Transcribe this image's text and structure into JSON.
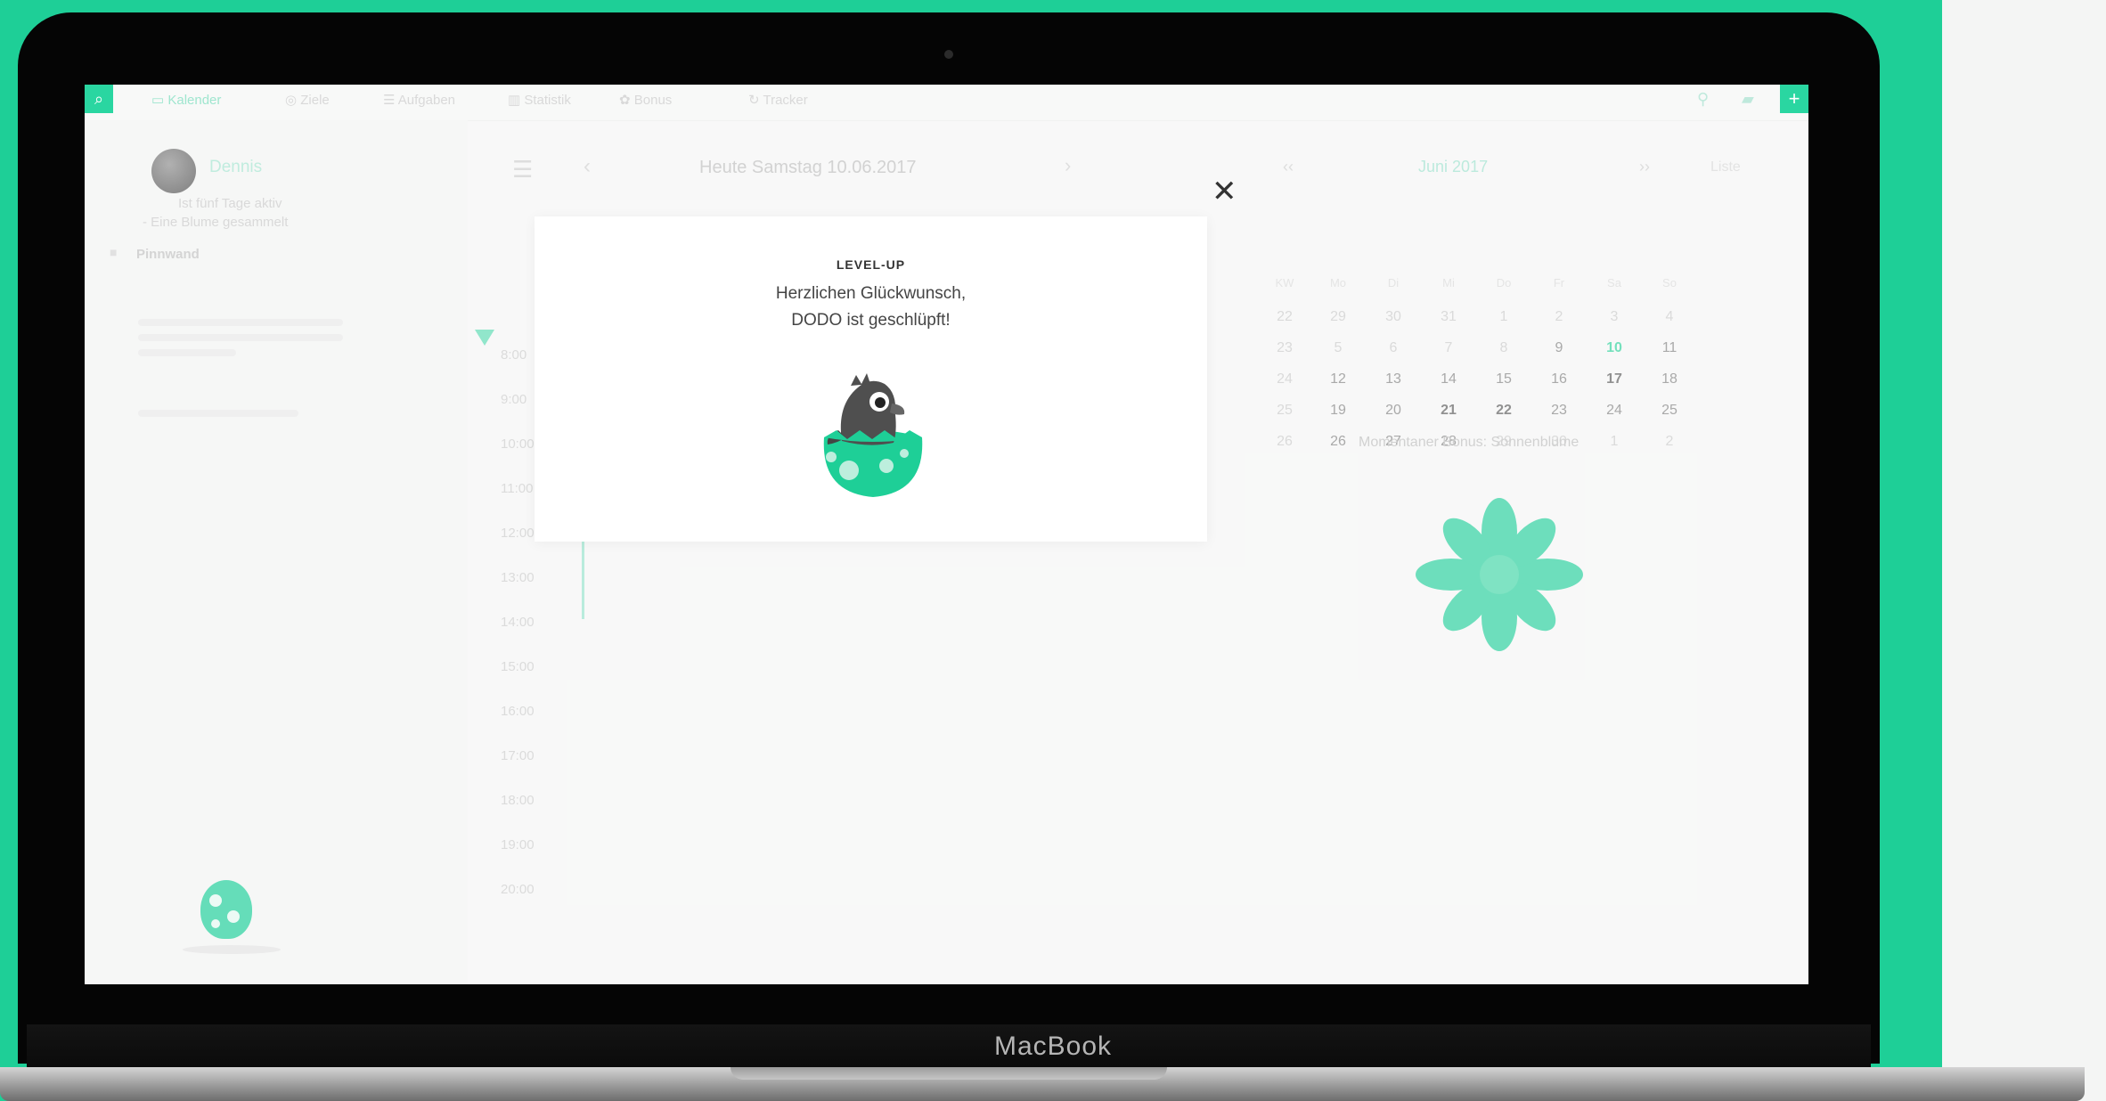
{
  "device": {
    "brand": "MacBook"
  },
  "app": {
    "nav_tabs": [
      {
        "label": "Kalender",
        "active": true
      },
      {
        "label": "Ziele",
        "active": false
      },
      {
        "label": "Aufgaben",
        "active": false
      },
      {
        "label": "Statistik",
        "active": false
      },
      {
        "label": "Bonus",
        "active": false
      },
      {
        "label": "Tracker",
        "active": false
      }
    ]
  },
  "sidebar": {
    "username": "Dennis",
    "status_line1": "Ist fünf Tage aktiv",
    "status_line2": "- Eine Blume gesammelt",
    "section_label": "Pinnwand"
  },
  "day_header": {
    "today_label": "Heute Samstag 10.06.2017"
  },
  "timeline": {
    "times": [
      "8:00",
      "9:00",
      "10:00",
      "11:00",
      "12:00",
      "13:00",
      "14:00",
      "15:00",
      "16:00",
      "17:00",
      "18:00",
      "19:00",
      "20:00"
    ]
  },
  "calendar": {
    "month": "Juni",
    "year": "2017",
    "option_label": "Liste",
    "weekday_headers": [
      "KW",
      "Mo",
      "Di",
      "Mi",
      "Do",
      "Fr",
      "Sa",
      "So"
    ],
    "rows": [
      [
        "22",
        "29",
        "30",
        "31",
        "1",
        "2",
        "3",
        "4"
      ],
      [
        "23",
        "5",
        "6",
        "7",
        "8",
        "9",
        "10",
        "11"
      ],
      [
        "24",
        "12",
        "13",
        "14",
        "15",
        "16",
        "17",
        "18"
      ],
      [
        "25",
        "19",
        "20",
        "21",
        "22",
        "23",
        "24",
        "25"
      ],
      [
        "26",
        "26",
        "27",
        "28",
        "29",
        "30",
        "1",
        "2"
      ]
    ],
    "today": "10"
  },
  "reward_panel": {
    "label": "Momentaner Bonus: Sonnenblume"
  },
  "modal": {
    "title": "LEVEL-UP",
    "line1": "Herzlichen Glückwunsch,",
    "line2": "DODO ist geschlüpft!"
  },
  "colors": {
    "accent": "#1ecf97",
    "laptop": "#050505"
  }
}
